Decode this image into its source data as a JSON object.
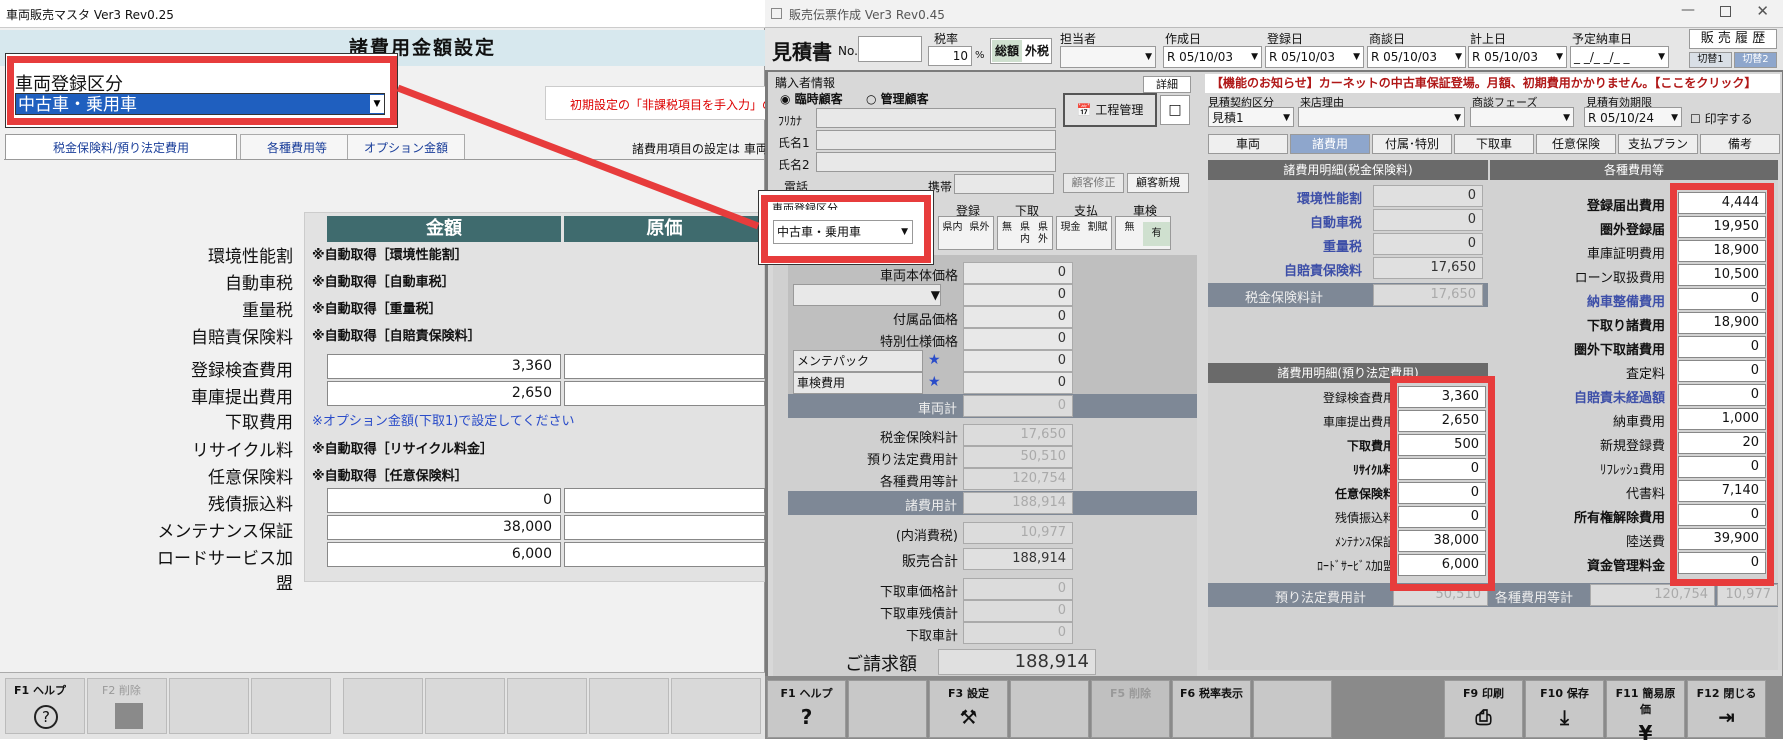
{
  "left": {
    "title": "車両販売マスタ Ver3 Rev0.25",
    "header": "諸費用金額設定",
    "notice": "初期設定の「非課税項目を手入力」の",
    "tabs": [
      "税金保険料/預り法定費用",
      "各種費用等",
      "オプション金額"
    ],
    "tab_note": "諸費用項目の設定は 車両",
    "col_headers": [
      "金額",
      "原価"
    ],
    "rows": [
      {
        "label": "環境性能割",
        "auto": "※自動取得［環境性能割］"
      },
      {
        "label": "自動車税",
        "auto": "※自動取得［自動車税］"
      },
      {
        "label": "重量税",
        "auto": "※自動取得［重量税］"
      },
      {
        "label": "自賠責保険料",
        "auto": "※自動取得［自賠責保険料］"
      },
      {
        "label": "登録検査費用",
        "value": "3,360"
      },
      {
        "label": "車庫提出費用",
        "value": "2,650"
      },
      {
        "label": "下取費用",
        "opt": "※オプション金額(下取1)で設定してください"
      },
      {
        "label": "リサイクル料",
        "auto": "※自動取得［リサイクル料金］"
      },
      {
        "label": "任意保険料",
        "auto": "※自動取得［任意保険料］"
      },
      {
        "label": "残債振込料",
        "value": "0"
      },
      {
        "label": "メンテナンス保証",
        "value": "38,000"
      },
      {
        "label": "ロードサービス加盟",
        "value": "6,000"
      }
    ],
    "fkeys": [
      "F1 ヘルプ",
      "F2 削除"
    ],
    "callout": {
      "label": "車両登録区分",
      "value": "中古車・乗用車"
    }
  },
  "right": {
    "title": "販売伝票作成 Ver3 Rev0.45",
    "doc_title": "見積書",
    "no_label": "No.",
    "tax_rate_label": "税率",
    "tax_rate": "10",
    "pct": "%",
    "tax_modes": [
      "総額",
      "外税"
    ],
    "staff_label": "担当者",
    "date_labels": [
      "作成日",
      "登録日",
      "商談日",
      "計上日",
      "予定納車日"
    ],
    "dates": [
      "R 05/10/03",
      "R 05/10/03",
      "R 05/10/03",
      "R 05/10/03",
      "_ _/_ _/_ _"
    ],
    "sales_history": "販 売 履 歴",
    "switch": [
      "切替1",
      "切替2"
    ],
    "buyer": {
      "section": "購入者情報",
      "detail": "詳細",
      "opt1": "臨時顧客",
      "opt2": "管理顧客",
      "kana": "ﾌﾘｶﾅ",
      "name1": "氏名1",
      "name2": "氏名2",
      "phone": "電話",
      "mobile": "携帯",
      "edit": "顧客修正",
      "new": "顧客新規"
    },
    "process_btn": "工程管理",
    "banner": "【機能のお知らせ】カーネットの中古車保証登場。月額、初期費用かかりません。【ここをクリック】",
    "contract_label": "見積契約区分",
    "contract": "見積1",
    "visit_label": "来店理由",
    "phase_label": "商談フェーズ",
    "expiry_label": "見積有効期限",
    "expiry": "R 05/10/24",
    "print_date": "印字する",
    "tabs": [
      "車両",
      "諸費用",
      "付属･特別",
      "下取車",
      "任意保険",
      "支払プラン",
      "備考"
    ],
    "callout": {
      "label": "車両登録区分",
      "value": "中古車・乗用車"
    },
    "mini_groups": [
      {
        "label": "登録",
        "a": "県内",
        "b": "県外"
      },
      {
        "label": "下取",
        "a": "無",
        "b": "県内",
        "c": "県外"
      },
      {
        "label": "支払",
        "a": "現金",
        "b": "割賦"
      },
      {
        "label": "車検",
        "a": "無",
        "b": "有"
      }
    ],
    "vehicle": {
      "rows": [
        {
          "label": "車両本体価格",
          "value": "0"
        },
        {
          "label": "",
          "value": "0"
        },
        {
          "label": "付属品価格",
          "value": "0"
        },
        {
          "label": "特別仕様価格",
          "value": "0"
        },
        {
          "label": "メンテパック",
          "value": "0"
        },
        {
          "label": "車検費用",
          "value": "0"
        }
      ],
      "vehicle_total_label": "車両計",
      "vehicle_total": "0",
      "sum_rows": [
        {
          "label": "税金保険料計",
          "value": "17,650"
        },
        {
          "label": "預り法定費用計",
          "value": "50,510"
        },
        {
          "label": "各種費用等計",
          "value": "120,754"
        }
      ],
      "misc_total_label": "諸費用計",
      "misc_total": "188,914",
      "tax_label": "(内消費税)",
      "tax": "10,977",
      "sales_total_label": "販売合計",
      "sales_total": "188,914",
      "trade_rows": [
        {
          "label": "下取車価格計",
          "value": "0"
        },
        {
          "label": "下取車残債計",
          "value": "0"
        },
        {
          "label": "下取車計",
          "value": "0"
        }
      ],
      "bill_label": "ご請求額",
      "bill": "188,914"
    },
    "tax_section": {
      "title": "諸費用明細(税金保険料)",
      "rows": [
        {
          "label": "環境性能割",
          "value": "0"
        },
        {
          "label": "自動車税",
          "value": "0"
        },
        {
          "label": "重量税",
          "value": "0"
        },
        {
          "label": "自賠責保険料",
          "value": "17,650"
        }
      ],
      "total_label": "税金保険料計",
      "total": "17,650"
    },
    "deposit_section": {
      "title": "諸費用明細(預り法定費用)",
      "rows": [
        {
          "label": "登録検査費用",
          "value": "3,360"
        },
        {
          "label": "車庫提出費用",
          "value": "2,650"
        },
        {
          "label": "下取費用",
          "value": "500"
        },
        {
          "label": "ﾘｻｲｸﾙ料",
          "value": "0"
        },
        {
          "label": "任意保険料",
          "value": "0"
        },
        {
          "label": "残債振込料",
          "value": "0"
        },
        {
          "label": "ﾒﾝﾃﾅﾝｽ保証",
          "value": "38,000"
        },
        {
          "label": "ﾛｰﾄﾞｻｰﾋﾞｽ加盟",
          "value": "6,000"
        }
      ],
      "total_label": "預り法定費用計",
      "total": "50,510"
    },
    "misc_section": {
      "title": "各種費用等",
      "rows": [
        {
          "label": "登録届出費用",
          "value": "4,444"
        },
        {
          "label": "圏外登録届",
          "value": "19,950"
        },
        {
          "label": "車庫証明費用",
          "value": "18,900"
        },
        {
          "label": "ローン取扱費用",
          "value": "10,500"
        },
        {
          "label": "納車整備費用",
          "value": "0"
        },
        {
          "label": "下取り諸費用",
          "value": "18,900"
        },
        {
          "label": "圏外下取諸費用",
          "value": "0"
        },
        {
          "label": "査定料",
          "value": "0"
        },
        {
          "label": "自賠責未経過額",
          "value": "0"
        },
        {
          "label": "納車費用",
          "value": "1,000"
        },
        {
          "label": "新規登録費",
          "value": "20"
        },
        {
          "label": "ﾘﾌﾚｯｼｭ費用",
          "value": "0"
        },
        {
          "label": "代書料",
          "value": "7,140"
        },
        {
          "label": "所有権解除費用",
          "value": "0"
        },
        {
          "label": "陸送費",
          "value": "39,900"
        },
        {
          "label": "資金管理料金",
          "value": "0"
        }
      ],
      "total_label": "各種費用等計",
      "total": "120,754",
      "total2": "10,977"
    },
    "fkeys": [
      "F1 ヘルプ",
      "",
      "F3 設定",
      "",
      "F5 削除",
      "F6 税率表示",
      "",
      "F9 印刷",
      "F10 保存",
      "F11 簡易原価",
      "F12 閉じる"
    ]
  }
}
